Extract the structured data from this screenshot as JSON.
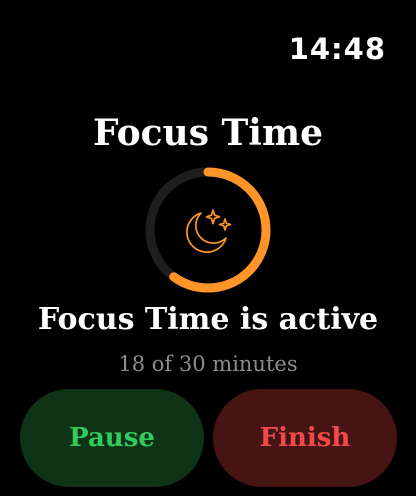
{
  "status_bar": {
    "time": "14:48"
  },
  "focus": {
    "title": "Focus Time",
    "status": "Focus Time is active",
    "progress_text": "18 of 30 minutes",
    "elapsed_minutes": 18,
    "total_minutes": 30,
    "icon": "moon-stars-icon"
  },
  "actions": {
    "pause_label": "Pause",
    "finish_label": "Finish"
  },
  "colors": {
    "background": "#000000",
    "accent": "#ff9428",
    "ring_track": "#1e1e1e",
    "pause_bg": "#0f3317",
    "pause_text": "#33cc5c",
    "finish_bg": "#471414",
    "finish_text": "#f24a4a"
  }
}
